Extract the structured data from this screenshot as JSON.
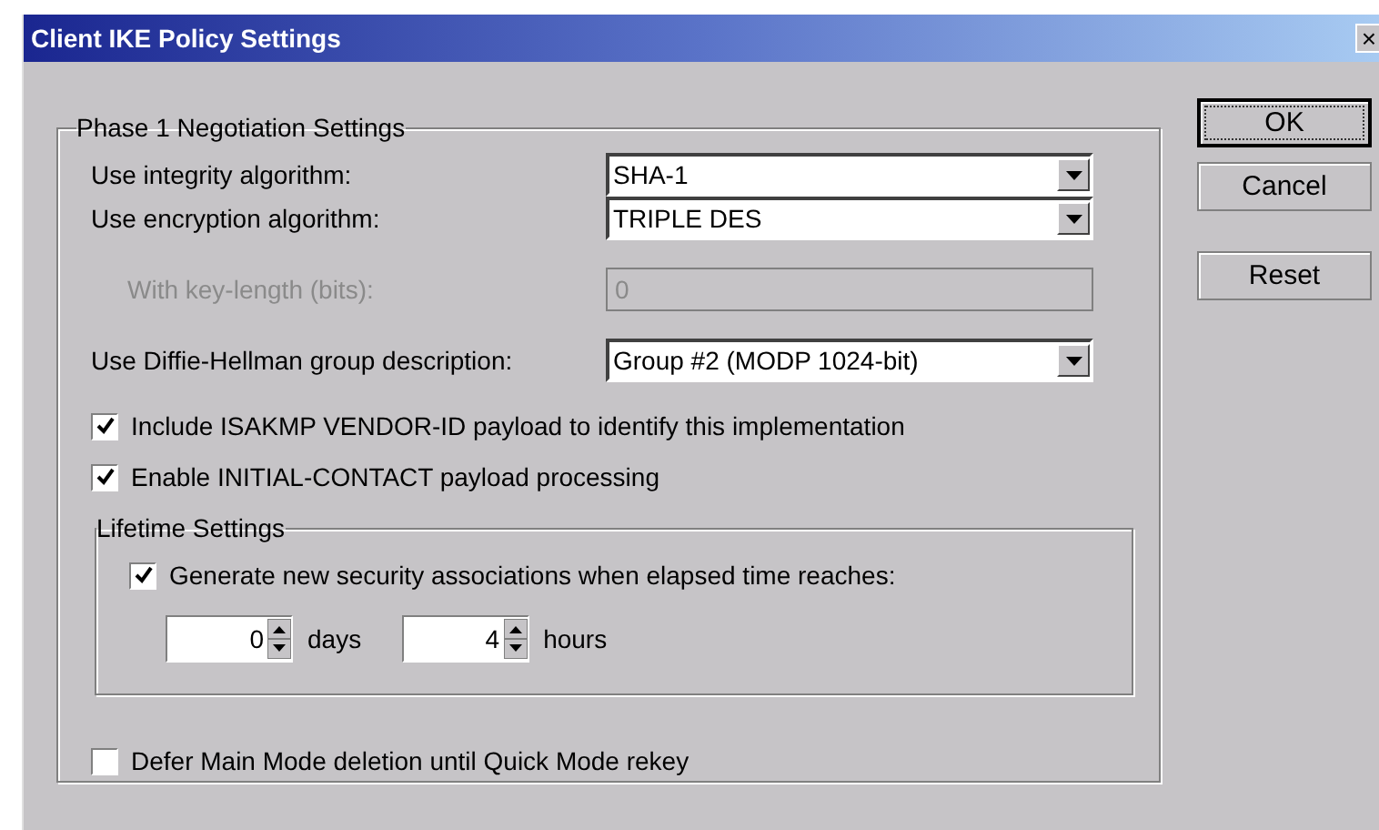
{
  "window": {
    "title": "Client IKE Policy Settings",
    "close": "×"
  },
  "phase1": {
    "legend": "Phase 1 Negotiation Settings",
    "fields": [
      {
        "kind": "dropdown",
        "label": "Use integrity algorithm:",
        "value": "SHA-1",
        "disabled": false
      },
      {
        "kind": "dropdown",
        "label": "Use encryption algorithm:",
        "value": "TRIPLE DES",
        "disabled": false
      },
      {
        "kind": "text",
        "label": "With key-length (bits):",
        "value": "0",
        "disabled": true
      },
      {
        "kind": "dropdown",
        "label": "Use Diffie-Hellman group description:",
        "value": "Group #2 (MODP 1024-bit)",
        "disabled": false
      }
    ],
    "options": [
      {
        "label": "Include ISAKMP VENDOR-ID payload to identify this implementation",
        "checked": true
      },
      {
        "label": "Enable INITIAL-CONTACT payload processing",
        "checked": true
      }
    ],
    "lifetime": {
      "legend": "Lifetime Settings",
      "option": {
        "label": "Generate new security associations when elapsed time reaches:",
        "checked": true
      },
      "spinners": [
        {
          "value": "0",
          "unit": "days"
        },
        {
          "value": "4",
          "unit": "hours"
        }
      ]
    },
    "defer": {
      "label": "Defer Main Mode deletion until Quick Mode rekey",
      "checked": false
    }
  },
  "buttons": [
    {
      "label": "OK",
      "default": true
    },
    {
      "label": "Cancel",
      "default": false
    },
    {
      "label": "Reset",
      "default": false
    }
  ]
}
